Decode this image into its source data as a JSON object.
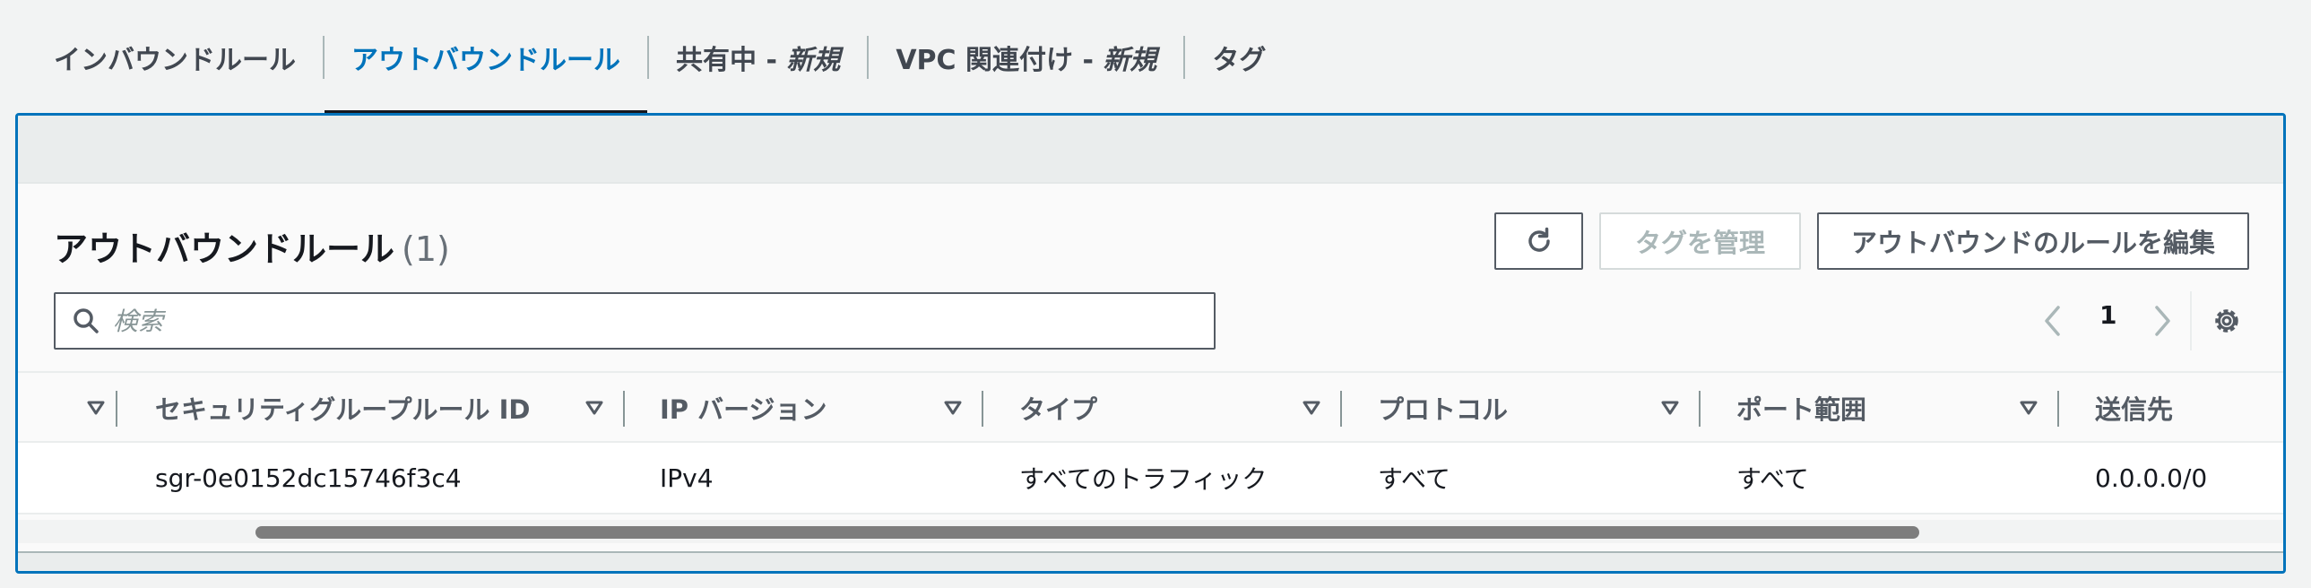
{
  "tabs": [
    {
      "label": "インバウンドルール",
      "suffix": ""
    },
    {
      "label": "アウトバウンドルール",
      "suffix": ""
    },
    {
      "label": "共有中 - ",
      "suffix": "新規"
    },
    {
      "label": "VPC 関連付け - ",
      "suffix": "新規"
    },
    {
      "label": "タグ",
      "suffix": ""
    }
  ],
  "active_tab": 1,
  "panel": {
    "title": "アウトバウンドルール",
    "count": "(1)",
    "refresh_icon": "refresh-icon",
    "manage_tags_label": "タグを管理",
    "edit_rules_label": "アウトバウンドのルールを編集"
  },
  "search": {
    "placeholder": "検索",
    "value": "",
    "icon": "search-icon"
  },
  "pagination": {
    "current_page": "1",
    "prev_icon": "chevron-left-icon",
    "next_icon": "chevron-right-icon",
    "settings_icon": "gear-icon"
  },
  "table": {
    "columns": [
      "セキュリティグループルール ID",
      "IP バージョン",
      "タイプ",
      "プロトコル",
      "ポート範囲",
      "送信先"
    ],
    "rows": [
      [
        "sgr-0e0152dc15746f3c4",
        "IPv4",
        "すべてのトラフィック",
        "すべて",
        "すべて",
        "0.0.0.0/0"
      ]
    ]
  },
  "colors": {
    "accent": "#0073bb",
    "text": "#16191f",
    "muted": "#545b64",
    "disabled": "#aab7b8"
  }
}
